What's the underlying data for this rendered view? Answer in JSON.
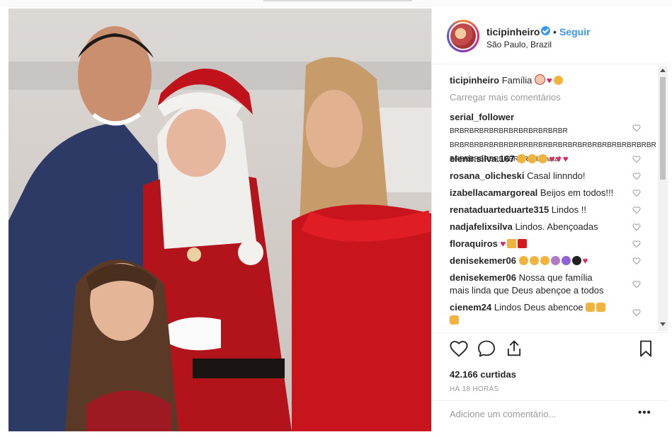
{
  "post": {
    "username": "ticipinheiro",
    "dot": "•",
    "follow_label": "Seguir",
    "location": "São Paulo, Brazil",
    "caption_text": "Família",
    "load_more": "Carregar mais comentários",
    "likes": "42.166 curtidas",
    "time": "HÁ 18 HORAS",
    "add_comment_placeholder": "Adicione um comentário...",
    "more_label": "•••"
  },
  "comments": [
    {
      "user": "serial_follower",
      "text_lines": [
        "BRBRBRBRBRBRBRBRBRBRBRBR",
        "BRBRBRBRBRBRBRBRBRBRBRBRBRBRBRBRBRBRBRBRBR",
        "BRBRBRBRBRBRBRBR feliz natal"
      ]
    },
    {
      "user": "elenir.silva.167",
      "text": ""
    },
    {
      "user": "rosana_olicheski",
      "text": "Casal linnndo!"
    },
    {
      "user": "izabellacamargoreal",
      "text": "Beijos em todos!!!"
    },
    {
      "user": "renataduarteduarte315",
      "text": "Lindos !!"
    },
    {
      "user": "nadjafelixsilva",
      "text": "Lindos. Abençoadas"
    },
    {
      "user": "floraquiros",
      "text": ""
    },
    {
      "user": "denisekemer06",
      "text": ""
    },
    {
      "user": "denisekemer06",
      "text_lines": [
        "Nossa que família",
        "mais linda que Deus abençoe a todos"
      ]
    },
    {
      "user": "cienem24",
      "text": "Lindos Deus abencoe"
    }
  ],
  "colors": {
    "accent": "#3897f0",
    "heart": "#e0245e",
    "muted": "#999999"
  },
  "icons": [
    "heart-icon",
    "comment-icon",
    "share-icon",
    "bookmark-icon",
    "verified-icon"
  ]
}
